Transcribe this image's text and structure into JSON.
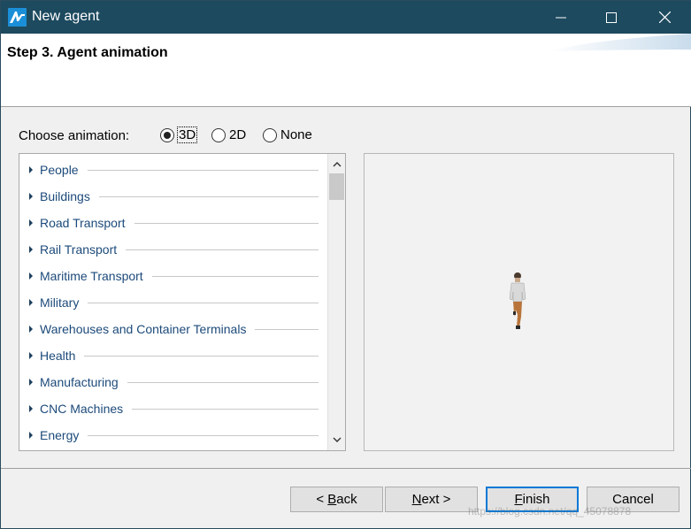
{
  "window": {
    "title": "New agent",
    "accent": "#1d4a5f"
  },
  "header": {
    "step_title": "Step 3. Agent animation"
  },
  "animation": {
    "label": "Choose animation:",
    "options": [
      {
        "label": "3D",
        "selected": true
      },
      {
        "label": "2D",
        "selected": false
      },
      {
        "label": "None",
        "selected": false
      }
    ]
  },
  "categories": [
    "People",
    "Buildings",
    "Road Transport",
    "Rail Transport",
    "Maritime Transport",
    "Military",
    "Warehouses and Container Terminals",
    "Health",
    "Manufacturing",
    "CNC Machines",
    "Energy"
  ],
  "buttons": {
    "back_prefix": "< ",
    "back_mnemonic": "B",
    "back_rest": "ack",
    "next_mnemonic": "N",
    "next_rest": "ext >",
    "finish_mnemonic": "F",
    "finish_rest": "inish",
    "cancel": "Cancel"
  },
  "watermark": "https://blog.csdn.net/qq_45078878",
  "icons": {
    "app": "anylogic-logo-icon",
    "minimize": "minimize-icon",
    "maximize": "maximize-icon",
    "close": "close-icon",
    "expand": "expand-arrow-icon",
    "scroll_up": "chevron-up-icon",
    "scroll_down": "chevron-down-icon"
  }
}
